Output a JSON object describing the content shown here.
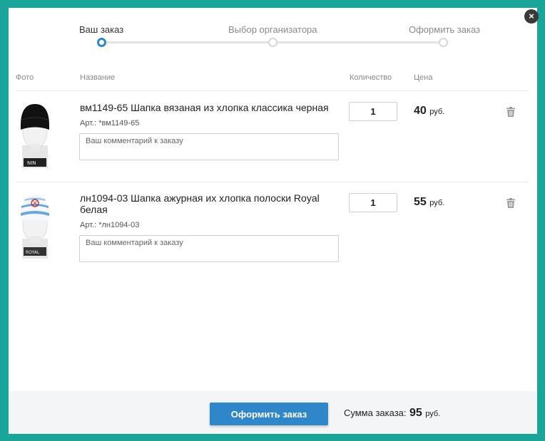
{
  "close_label": "×",
  "steps": [
    {
      "label": "Ваш заказ",
      "active": true
    },
    {
      "label": "Выбор организатора",
      "active": false
    },
    {
      "label": "Оформить заказ",
      "active": false
    }
  ],
  "columns": {
    "photo": "Фото",
    "name": "Название",
    "quantity": "Количество",
    "price": "Цена"
  },
  "items": [
    {
      "name": "вм1149-65 Шапка вязаная из хлопка классика черная",
      "sku": "Арт.: *вм1149-65",
      "comment_placeholder": "Ваш комментарий к заказу",
      "quantity": "1",
      "price": "40",
      "currency": "руб.",
      "image": "black-knit-hat-on-mannequin"
    },
    {
      "name": "лн1094-03 Шапка ажурная их хлопка полоски Royal белая",
      "sku": "Арт.: *лн1094-03",
      "comment_placeholder": "Ваш комментарий к заказу",
      "quantity": "1",
      "price": "55",
      "currency": "руб.",
      "image": "striped-white-blue-hat-on-mannequin"
    }
  ],
  "footer": {
    "checkout_label": "Оформить заказ",
    "total_label": "Сумма заказа:",
    "total_value": "95",
    "total_currency": "руб."
  },
  "colors": {
    "background": "#1aa59b",
    "accent": "#2f86c9",
    "footer_bg": "#f4f5f6"
  }
}
